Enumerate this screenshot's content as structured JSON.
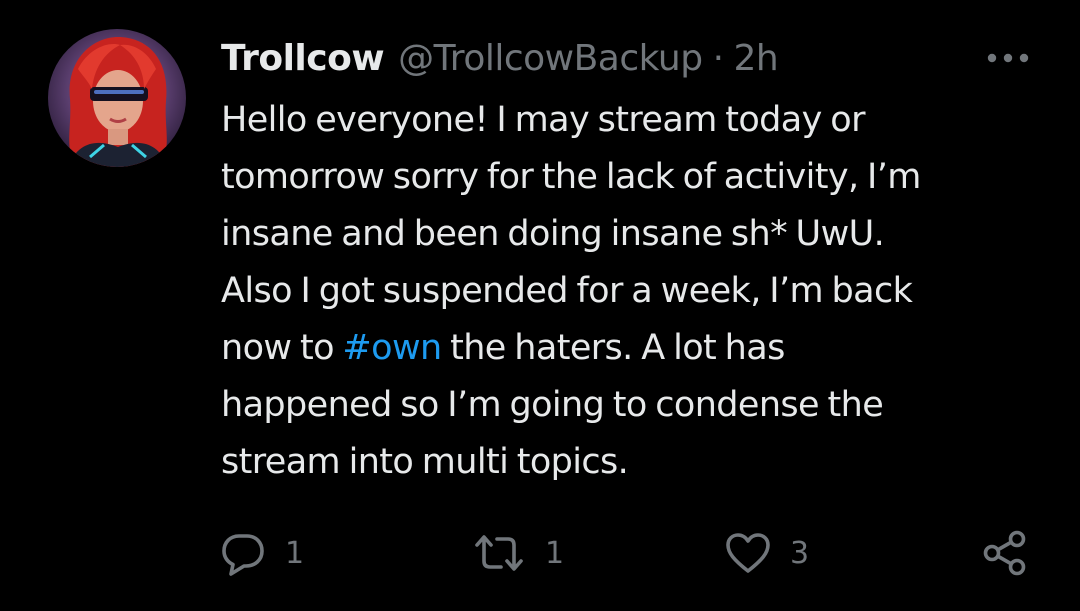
{
  "tweet": {
    "display_name": "Trollcow",
    "handle": "@TrollcowBackup",
    "separator": "·",
    "time": "2h",
    "text_lines": [
      "Hello everyone! I may stream today or",
      "tomorrow sorry for the lack of activity, I’m",
      "insane and been doing insane sh* UwU.",
      "Also I got suspended for a week, I’m back",
      "now to ",
      "happened so I’m going to condense the",
      "stream into multi topics."
    ],
    "hashtag": "#own",
    "line5_after": " the haters. A lot has"
  },
  "actions": {
    "reply_count": "1",
    "retweet_count": "1",
    "like_count": "3"
  },
  "icons": {
    "more": "more-horizontal-icon",
    "reply": "reply-bubble-icon",
    "retweet": "retweet-icon",
    "like": "heart-icon",
    "share": "share-icon"
  },
  "colors": {
    "background": "#000000",
    "text": "#e7e9ea",
    "secondary": "#71767b",
    "link": "#1d9bf0"
  }
}
